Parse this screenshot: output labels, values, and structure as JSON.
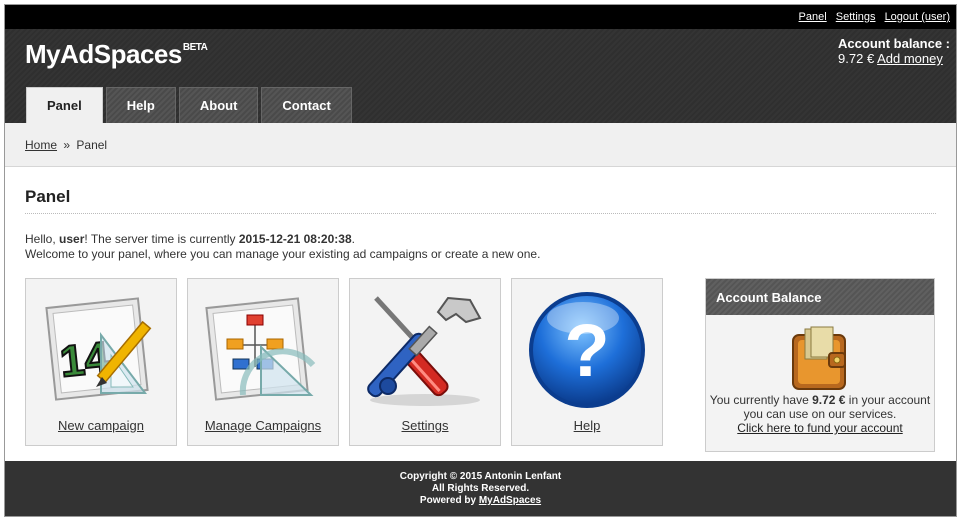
{
  "topbar": {
    "links": [
      "Panel",
      "Settings",
      "Logout (user)"
    ]
  },
  "header": {
    "logo": "MyAdSpaces",
    "logo_badge": "BETA",
    "balance_label": "Account balance :",
    "balance_value": "9.72 €",
    "add_money": "Add money"
  },
  "tabs": [
    {
      "label": "Panel",
      "active": true
    },
    {
      "label": "Help",
      "active": false
    },
    {
      "label": "About",
      "active": false
    },
    {
      "label": "Contact",
      "active": false
    }
  ],
  "breadcrumb": {
    "home": "Home",
    "separator": "»",
    "current": "Panel"
  },
  "main": {
    "title": "Panel",
    "hello_prefix": "Hello, ",
    "username": "user",
    "server_time_text": "! The server time is currently ",
    "server_time": "2015-12-21 08:20:38",
    "period": ".",
    "welcome_line": "Welcome to your panel, where you can manage your existing ad campaigns or create a new one."
  },
  "tiles": [
    {
      "label": "New campaign",
      "icon": "calendar-pencil-icon"
    },
    {
      "label": "Manage Campaigns",
      "icon": "flowchart-icon"
    },
    {
      "label": "Settings",
      "icon": "wrench-screwdriver-icon"
    },
    {
      "label": "Help",
      "icon": "question-icon"
    }
  ],
  "account_panel": {
    "title": "Account Balance",
    "text_prefix": "You currently have ",
    "amount": "9.72 €",
    "text_suffix": " in your account you can use on our services.",
    "fund_link": "Click here to fund your account",
    "icon": "wallet-icon"
  },
  "footer": {
    "copyright": "Copyright © 2015 Antonin Lenfant",
    "rights": "All Rights Reserved.",
    "powered_prefix": "Powered by ",
    "powered_link": "MyAdSpaces"
  },
  "colors": {
    "topbar": "#000000",
    "header": "#333333",
    "help_blue": "#1e6fd9",
    "wrench_red": "#c8201c"
  }
}
